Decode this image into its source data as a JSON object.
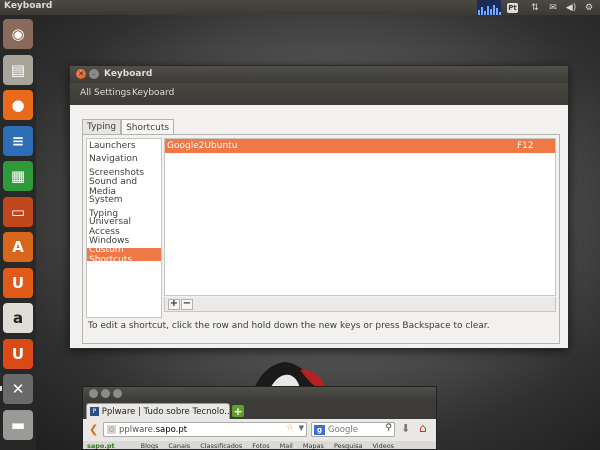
{
  "top_panel": {
    "title": "Keyboard",
    "tray": {
      "layout_badge": "Pt",
      "icons": [
        "system-monitor-icon",
        "network-arrows-icon",
        "mail-icon",
        "volume-icon",
        "settings-gear-icon"
      ]
    }
  },
  "launcher": {
    "items": [
      {
        "name": "ubuntu-dash",
        "glyph": "◉",
        "bg": "#8a6a5a"
      },
      {
        "name": "files",
        "glyph": "▤",
        "bg": "#a8a49a"
      },
      {
        "name": "firefox",
        "glyph": "●",
        "bg": "#e86a1a"
      },
      {
        "name": "libreoffice-writer",
        "glyph": "≡",
        "bg": "#2d6db5"
      },
      {
        "name": "libreoffice-calc",
        "glyph": "▦",
        "bg": "#2f9a3a"
      },
      {
        "name": "libreoffice-impress",
        "glyph": "▭",
        "bg": "#c0461c"
      },
      {
        "name": "software-center",
        "glyph": "A",
        "bg": "#d8661c"
      },
      {
        "name": "ubuntu-one",
        "glyph": "U",
        "bg": "#e05a1a"
      },
      {
        "name": "amazon",
        "glyph": "a",
        "bg": "#e0dcd6"
      },
      {
        "name": "ubuntu-one-music",
        "glyph": "U",
        "bg": "#d94a16"
      },
      {
        "name": "system-settings",
        "glyph": "✕",
        "bg": "#6a6a6a"
      },
      {
        "name": "removable-drive",
        "glyph": "▬",
        "bg": "#9a9a96"
      }
    ]
  },
  "keyboard_window": {
    "title": "Keyboard",
    "toolbar": {
      "all_settings": "All Settings",
      "current": "Keyboard"
    },
    "tabs": [
      {
        "label": "Typing"
      },
      {
        "label": "Shortcuts"
      }
    ],
    "categories": [
      "Launchers",
      "Navigation",
      "Screenshots",
      "Sound and Media",
      "System",
      "Typing",
      "Universal Access",
      "Windows",
      "Custom Shortcuts"
    ],
    "selected_category": "Custom Shortcuts",
    "shortcuts": [
      {
        "name": "Google2Ubuntu",
        "key": "F12"
      }
    ],
    "add_label": "+",
    "remove_label": "−",
    "hint": "To edit a shortcut, click the row and hold down the new keys or press Backspace to clear."
  },
  "firefox_window": {
    "tab_title": "Pplware | Tudo sobre Tecnolo...",
    "tab_icon_text": "P",
    "new_tab_label": "+",
    "url_prefix": "pplware.",
    "url_domain": "sapo.pt",
    "search_placeholder": "Google",
    "search_engine_letter": "g",
    "bookmarks": [
      "sapo.pt",
      "Blogs",
      "Canais",
      "Classificados",
      "Fotos",
      "Mail",
      "Mapas",
      "Pesquisa",
      "Videos"
    ]
  },
  "colors": {
    "accent_orange": "#f07746",
    "panel_dark": "#3c3b37",
    "window_bg": "#f2f1f0"
  }
}
